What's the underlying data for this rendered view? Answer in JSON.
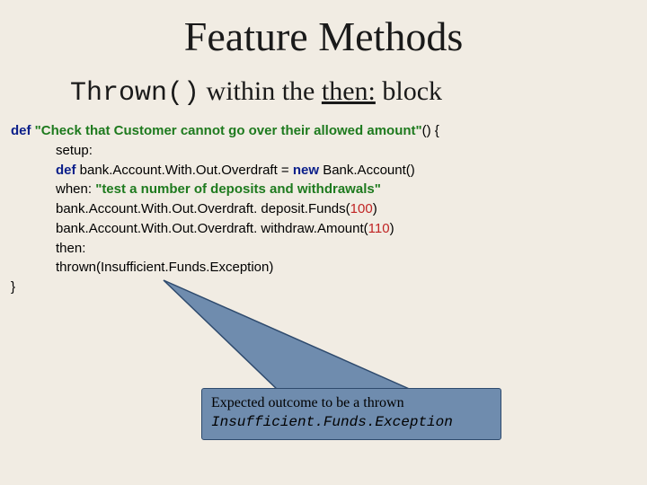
{
  "title": "Feature Methods",
  "subtitle": {
    "mono": "Thrown()",
    "mid": " within the ",
    "under": "then:",
    "tail": " block"
  },
  "code": {
    "l1_def": "def ",
    "l1_str": "\"Check that Customer cannot go over their allowed amount\"",
    "l1_tail": "() {",
    "l2": "setup:",
    "l3_def": "def ",
    "l3_lhs": "bank.Account.With.Out.Overdraft = ",
    "l3_new": "new ",
    "l3_rhs": "Bank.Account()",
    "l4_when": "when: ",
    "l4_str": "\"test a number of deposits and withdrawals\"",
    "l5_a": "bank.Account.With.Out.Overdraft. deposit.Funds(",
    "l5_n": "100",
    "l5_b": ")",
    "l6_a": "bank.Account.With.Out.Overdraft. withdraw.Amount(",
    "l6_n": "110",
    "l6_b": ")",
    "l7": "then:",
    "l8": "thrown(Insufficient.Funds.Exception)",
    "l9": "}"
  },
  "callout": {
    "line1": "Expected outcome to be a thrown",
    "exception": "Insufficient.Funds.Exception"
  }
}
